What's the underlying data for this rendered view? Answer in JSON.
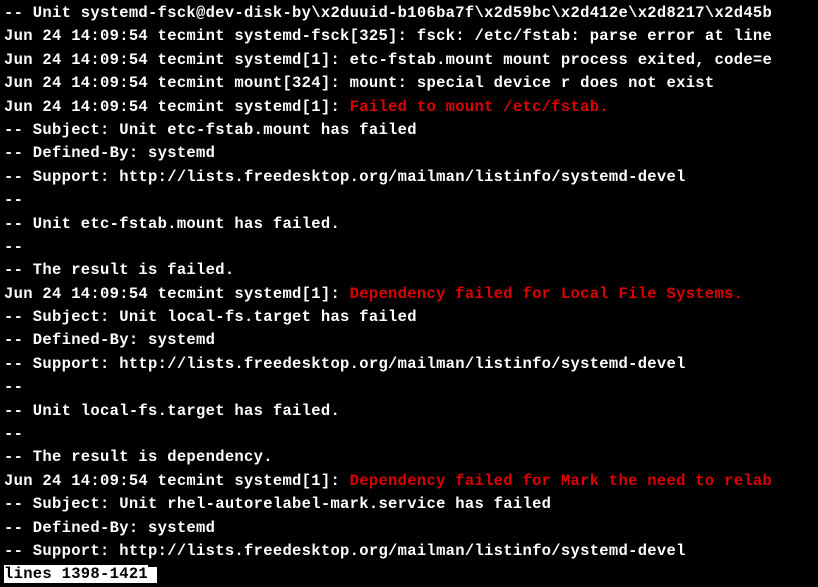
{
  "lines": [
    {
      "segments": [
        {
          "text": "-- Unit systemd-fsck@dev-disk-by\\x2duuid-b106ba7f\\x2d59bc\\x2d412e\\x2d8217\\x2d45b"
        }
      ]
    },
    {
      "segments": [
        {
          "text": "Jun 24 14:09:54 tecmint systemd-fsck[325]: fsck: /etc/fstab: parse error at line"
        }
      ]
    },
    {
      "segments": [
        {
          "text": "Jun 24 14:09:54 tecmint systemd[1]: etc-fstab.mount mount process exited, code=e"
        }
      ]
    },
    {
      "segments": [
        {
          "text": "Jun 24 14:09:54 tecmint mount[324]: mount: special device r does not exist"
        }
      ]
    },
    {
      "segments": [
        {
          "text": "Jun 24 14:09:54 tecmint systemd[1]: "
        },
        {
          "text": "Failed to mount /etc/fstab.",
          "red": true
        }
      ]
    },
    {
      "segments": [
        {
          "text": "-- Subject: Unit etc-fstab.mount has failed"
        }
      ]
    },
    {
      "segments": [
        {
          "text": "-- Defined-By: systemd"
        }
      ]
    },
    {
      "segments": [
        {
          "text": "-- Support: http://lists.freedesktop.org/mailman/listinfo/systemd-devel"
        }
      ]
    },
    {
      "segments": [
        {
          "text": "--"
        }
      ]
    },
    {
      "segments": [
        {
          "text": "-- Unit etc-fstab.mount has failed."
        }
      ]
    },
    {
      "segments": [
        {
          "text": "--"
        }
      ]
    },
    {
      "segments": [
        {
          "text": "-- The result is failed."
        }
      ]
    },
    {
      "segments": [
        {
          "text": "Jun 24 14:09:54 tecmint systemd[1]: "
        },
        {
          "text": "Dependency failed for Local File Systems.",
          "red": true
        }
      ]
    },
    {
      "segments": [
        {
          "text": "-- Subject: Unit local-fs.target has failed"
        }
      ]
    },
    {
      "segments": [
        {
          "text": "-- Defined-By: systemd"
        }
      ]
    },
    {
      "segments": [
        {
          "text": "-- Support: http://lists.freedesktop.org/mailman/listinfo/systemd-devel"
        }
      ]
    },
    {
      "segments": [
        {
          "text": "--"
        }
      ]
    },
    {
      "segments": [
        {
          "text": "-- Unit local-fs.target has failed."
        }
      ]
    },
    {
      "segments": [
        {
          "text": "--"
        }
      ]
    },
    {
      "segments": [
        {
          "text": "-- The result is dependency."
        }
      ]
    },
    {
      "segments": [
        {
          "text": "Jun 24 14:09:54 tecmint systemd[1]: "
        },
        {
          "text": "Dependency failed for Mark the need to relab",
          "red": true
        }
      ]
    },
    {
      "segments": [
        {
          "text": "-- Subject: Unit rhel-autorelabel-mark.service has failed"
        }
      ]
    },
    {
      "segments": [
        {
          "text": "-- Defined-By: systemd"
        }
      ]
    },
    {
      "segments": [
        {
          "text": "-- Support: http://lists.freedesktop.org/mailman/listinfo/systemd-devel"
        }
      ]
    }
  ],
  "status": "lines 1398-1421"
}
